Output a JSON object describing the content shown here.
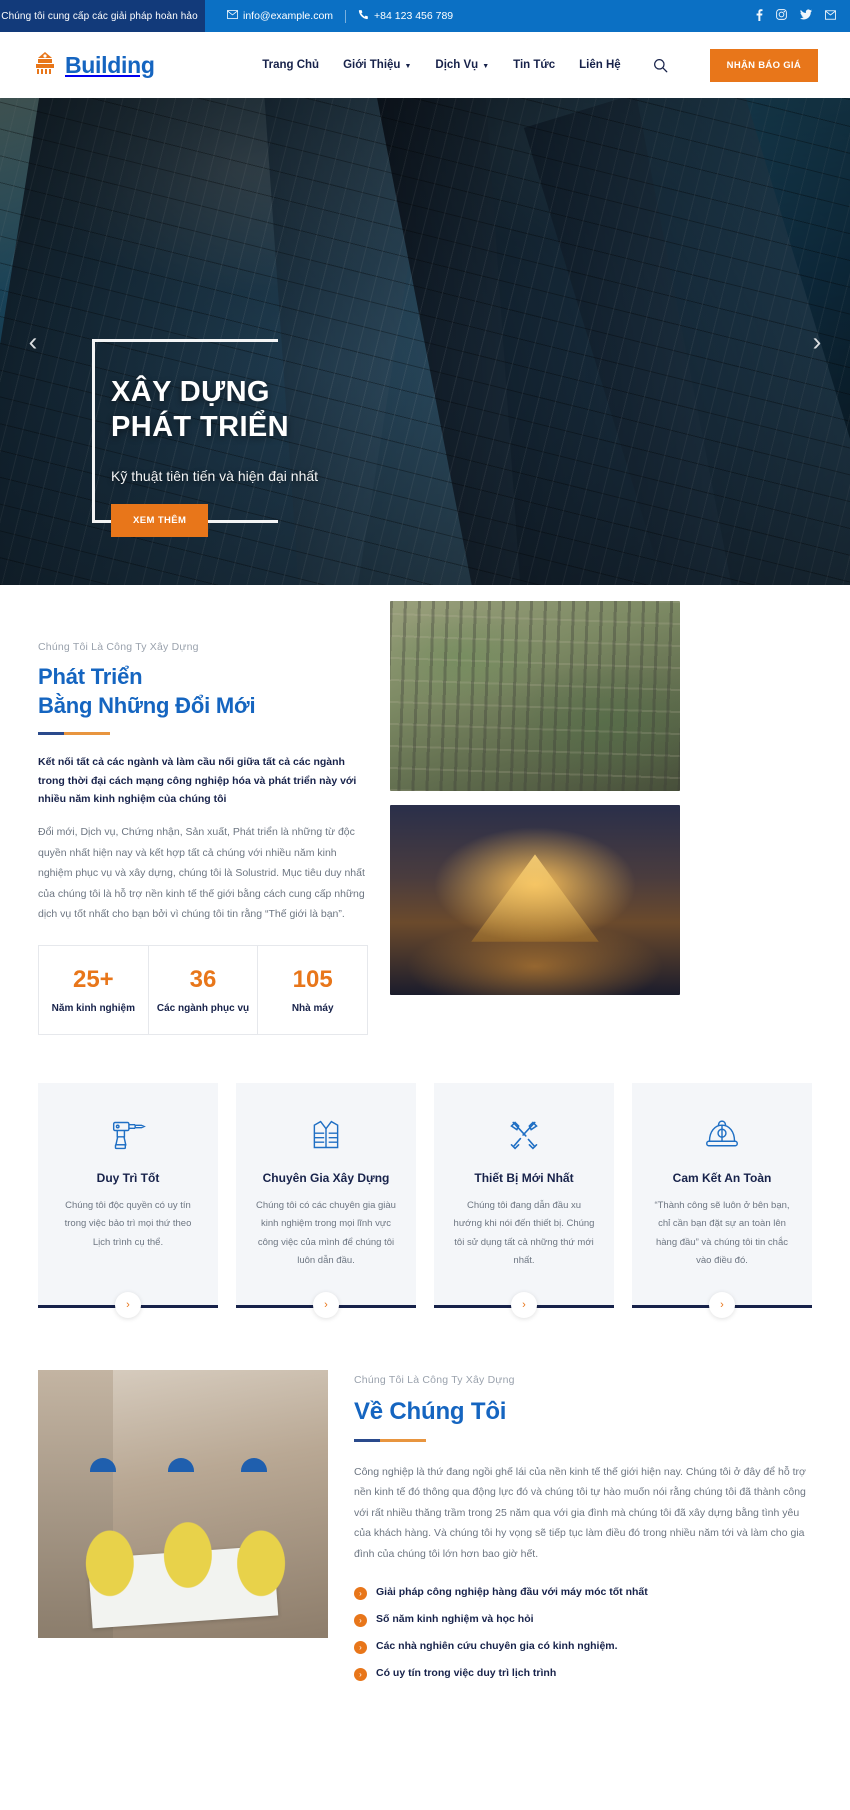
{
  "topbar": {
    "tagline": "Chúng tôi cung cấp các giải pháp hoàn hảo",
    "email": "info@example.com",
    "phone": "+84 123 456 789",
    "socials": [
      "facebook-icon",
      "instagram-icon",
      "twitter-icon",
      "envelope-icon"
    ],
    "colors": {
      "left_bg": "#123a7a",
      "right_bg": "#0b70c4"
    }
  },
  "header": {
    "brand": "Building",
    "nav": [
      {
        "label": "Trang Chủ",
        "has_dropdown": false
      },
      {
        "label": "Giới Thiệu",
        "has_dropdown": true
      },
      {
        "label": "Dịch Vụ",
        "has_dropdown": true
      },
      {
        "label": "Tin Tức",
        "has_dropdown": false
      },
      {
        "label": "Liên Hệ",
        "has_dropdown": false
      }
    ],
    "search_icon": "search-icon",
    "quote_button": "NHẬN BÁO GIÁ",
    "accent": "#e8761a"
  },
  "hero": {
    "title_line1": "XÂY DỰNG",
    "title_line2": "PHÁT TRIỂN",
    "subtitle": "Kỹ thuật tiên tiến và hiện đại nhất",
    "cta": "XEM THÊM",
    "prev": "‹",
    "next": "›"
  },
  "develop": {
    "eyebrow": "Chúng Tôi Là Công Ty Xây Dựng",
    "title_line1": "Phát Triển",
    "title_line2": "Bằng Những Đổi Mới",
    "lead": "Kết nối tất cả các ngành và làm cầu nối giữa tất cả các ngành trong thời đại cách mạng công nghiệp hóa và phát triển này với nhiều năm kinh nghiệm của chúng tôi",
    "paragraph": "Đổi mới, Dịch vụ, Chứng nhận, Sản xuất, Phát triển là những từ độc quyền nhất hiện nay và kết hợp tất cả chúng với nhiều năm kinh nghiệm phục vụ và xây dựng, chúng tôi là Solustrid. Mục tiêu duy nhất của chúng tôi là hỗ trợ nền kinh tế thế giới bằng cách cung cấp những dịch vụ tốt nhất cho bạn bởi vì chúng tôi tin rằng “Thế giới là bạn”.",
    "stats": [
      {
        "number": "25+",
        "label": "Năm kinh nghiệm"
      },
      {
        "number": "36",
        "label": "Các ngành phục vụ"
      },
      {
        "number": "105",
        "label": "Nhà máy"
      }
    ],
    "images": [
      "industrial-plant-photo",
      "louvre-pyramid-photo"
    ]
  },
  "features": [
    {
      "icon": "drill-icon",
      "title": "Duy Trì Tốt",
      "text": "Chúng tôi độc quyền có uy tín trong việc bảo trì mọi thứ theo Lịch trình cụ thể.",
      "next": "›"
    },
    {
      "icon": "safety-vest-icon",
      "title": "Chuyên Gia Xây Dựng",
      "text": "Chúng tôi có các chuyên gia giàu kinh nghiệm trong mọi lĩnh vực công việc của mình để chúng tôi luôn dẫn đầu.",
      "next": "›"
    },
    {
      "icon": "tools-icon",
      "title": "Thiết Bị Mới Nhất",
      "text": "Chúng tôi đang dẫn đầu xu hướng khi nói đến thiết bị. Chúng tôi sử dụng tất cả những thứ mới nhất.",
      "next": "›"
    },
    {
      "icon": "helmet-shield-icon",
      "title": "Cam Kết An Toàn",
      "text": "“Thành công sẽ luôn ở bên bạn, chỉ cần bạn đặt sự an toàn lên hàng đầu” và chúng tôi tin chắc vào điều đó.",
      "next": "›"
    }
  ],
  "aboutus": {
    "eyebrow": "Chúng Tôi Là Công Ty Xây Dựng",
    "title": "Về Chúng Tôi",
    "paragraph": "Công nghiệp là thứ đang ngồi ghế lái của nền kinh tế thế giới hiện nay. Chúng tôi ở đây để hỗ trợ nền kinh tế đó thông qua động lực đó và chúng tôi tự hào muốn nói rằng chúng tôi đã thành công với rất nhiều thăng trầm trong 25 năm qua với gia đình mà chúng tôi đã xây dựng bằng tình yêu của khách hàng. Và chúng tôi hy vọng sẽ tiếp tục làm điều đó trong nhiều năm tới và làm cho gia đình của chúng tôi lớn hơn bao giờ hết.",
    "list": [
      "Giải pháp công nghiệp hàng đầu với máy móc tốt nhất",
      "Số năm kinh nghiệm và học hỏi",
      "Các nhà nghiên cứu chuyên gia có kinh nghiệm.",
      "Có uy tín trong việc duy trì lịch trình"
    ],
    "image": "workers-blueprint-photo"
  }
}
